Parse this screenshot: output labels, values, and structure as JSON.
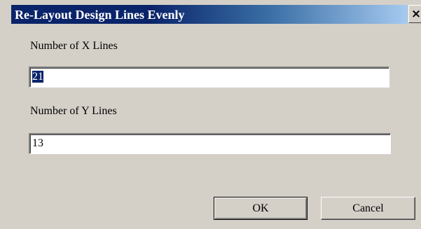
{
  "dialog": {
    "title": "Re-Layout Design Lines Evenly",
    "close_label": "×"
  },
  "fields": {
    "x_lines": {
      "label": "Number of X Lines",
      "value": "21"
    },
    "y_lines": {
      "label": "Number of Y Lines",
      "value": "13"
    }
  },
  "buttons": {
    "ok_label": "OK",
    "cancel_label": "Cancel"
  },
  "colors": {
    "dialog_bg": "#d4d0c8",
    "title_bar_start": "#0a246a",
    "title_bar_end": "#a6caf0",
    "selection": "#0a246a"
  }
}
